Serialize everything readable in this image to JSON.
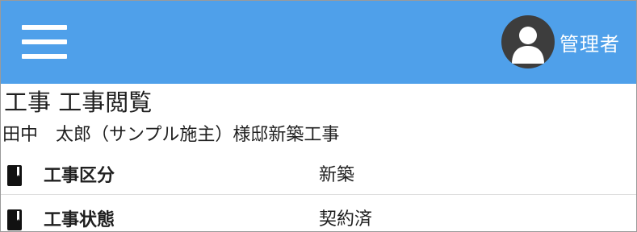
{
  "header": {
    "menu_icon": "hamburger-menu-icon",
    "user": {
      "avatar_icon": "user-silhouette-icon",
      "name": "管理者"
    },
    "background_color": "#4fa0ea"
  },
  "page": {
    "title": "工事 工事閲覧",
    "subtitle": "田中　太郎（サンプル施主）様邸新築工事"
  },
  "details": [
    {
      "icon": "book-icon",
      "label": "工事区分",
      "value": "新築"
    },
    {
      "icon": "book-icon",
      "label": "工事状態",
      "value": "契約済"
    }
  ]
}
